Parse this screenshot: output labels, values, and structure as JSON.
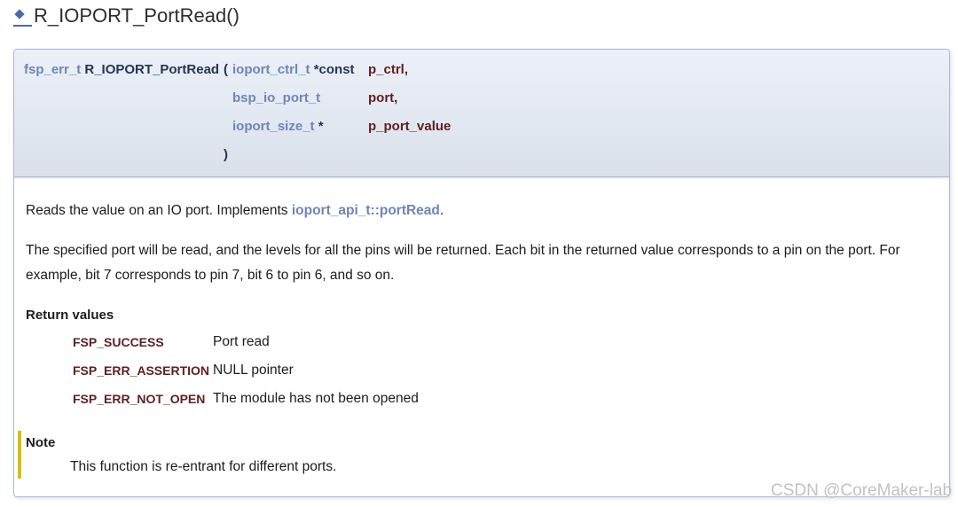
{
  "title": {
    "anchor_icon": "diamond-icon",
    "text": "R_IOPORT_PortRead()"
  },
  "prototype": {
    "return_type": "fsp_err_t",
    "function_name": "R_IOPORT_PortRead",
    "open_paren": "(",
    "close_paren": ")",
    "params": [
      {
        "type": "ioport_ctrl_t",
        "qualifier": "*const",
        "name": "p_ctrl,"
      },
      {
        "type": "bsp_io_port_t",
        "name": "port,"
      },
      {
        "type": "ioport_size_t",
        "qualifier": "*",
        "name": "p_port_value"
      }
    ]
  },
  "description": {
    "summary_text": "Reads the value on an IO port. Implements ",
    "summary_link": "ioport_api_t::portRead",
    "summary_end": ".",
    "details": "The specified port will be read, and the levels for all the pins will be returned. Each bit in the returned value corresponds to a pin on the port. For example, bit 7 corresponds to pin 7, bit 6 to pin 6, and so on."
  },
  "return_values": {
    "heading": "Return values",
    "items": [
      {
        "code": "FSP_SUCCESS",
        "meaning": "Port read"
      },
      {
        "code": "FSP_ERR_ASSERTION",
        "meaning": "NULL pointer"
      },
      {
        "code": "FSP_ERR_NOT_OPEN",
        "meaning": "The module has not been opened"
      }
    ]
  },
  "note": {
    "heading": "Note",
    "text": "This function is re-entrant for different ports."
  },
  "watermark": "CSDN @CoreMaker-lab",
  "colors": {
    "link": "#6e86b6",
    "function_name": "#253555",
    "param_name": "#602020",
    "note_bar": "#d0c20f",
    "prototype_bg": "#e2e8f2",
    "border": "#a8b8d9",
    "anchor": "#4a6aab",
    "body_text": "#1c1c1c",
    "title_text": "#2e2e2e",
    "watermark": "#c2c2c2"
  }
}
